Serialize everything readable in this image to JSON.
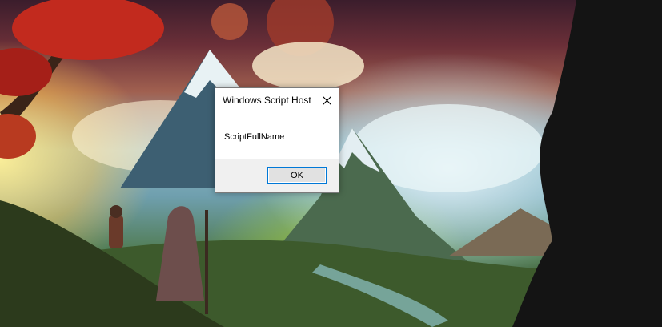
{
  "dialog": {
    "title": "Windows Script Host",
    "message": "ScriptFullName",
    "ok_label": "OK",
    "close_icon": "close-icon"
  },
  "colors": {
    "dialog_bg": "#ffffff",
    "footer_bg": "#f0f0f0",
    "button_border": "#0078d7"
  }
}
